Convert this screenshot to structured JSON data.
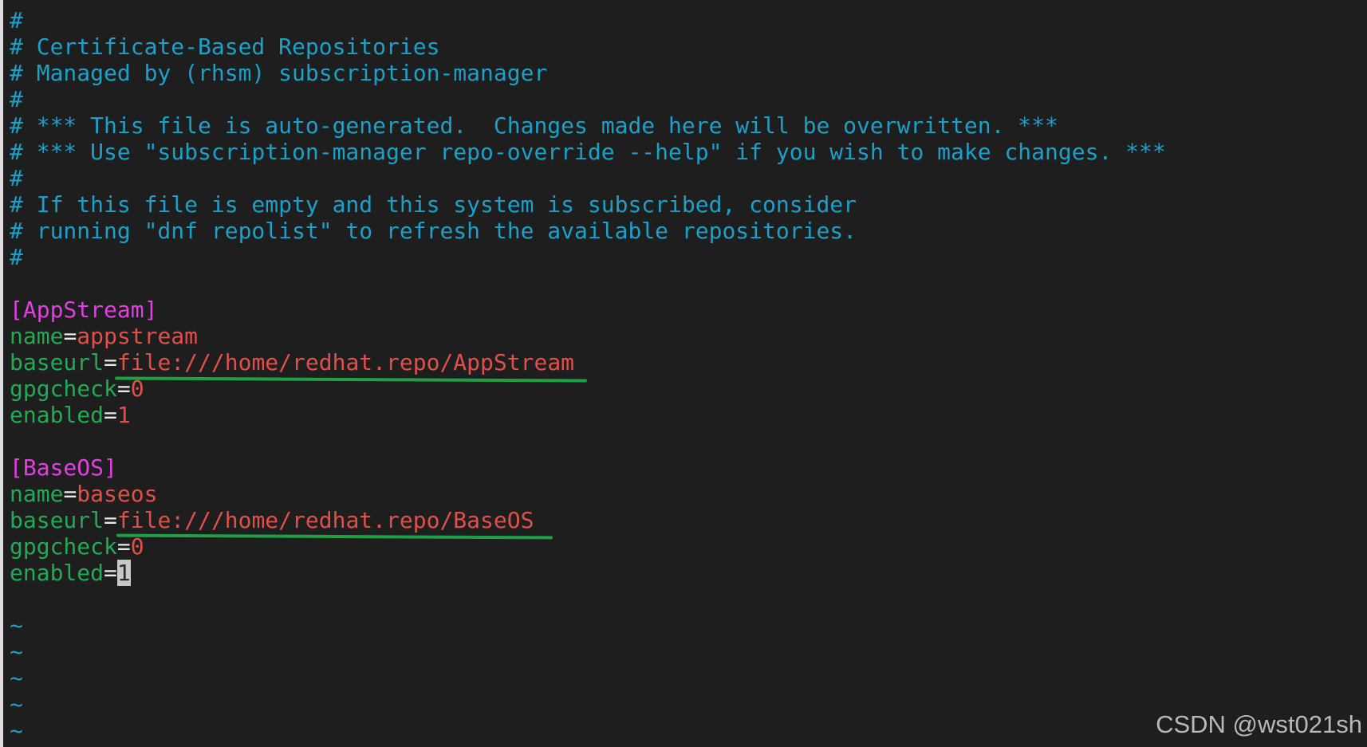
{
  "comments": [
    "#",
    "# Certificate-Based Repositories",
    "# Managed by (rhsm) subscription-manager",
    "#",
    "# *** This file is auto-generated.  Changes made here will be overwritten. ***",
    "# *** Use \"subscription-manager repo-override --help\" if you wish to make changes. ***",
    "#",
    "# If this file is empty and this system is subscribed, consider",
    "# running \"dnf repolist\" to refresh the available repositories.",
    "#"
  ],
  "repos": [
    {
      "section": "[AppStream]",
      "name_key": "name",
      "name_value": "appstream",
      "baseurl_key": "baseurl",
      "baseurl_value": "file:///home/redhat.repo/AppStream",
      "gpgcheck_key": "gpgcheck",
      "gpgcheck_value": "0",
      "enabled_key": "enabled",
      "enabled_value": "1"
    },
    {
      "section": "[BaseOS]",
      "name_key": "name",
      "name_value": "baseos",
      "baseurl_key": "baseurl",
      "baseurl_value": "file:///home/redhat.repo/BaseOS",
      "gpgcheck_key": "gpgcheck",
      "gpgcheck_value": "0",
      "enabled_key": "enabled",
      "enabled_value": "1"
    }
  ],
  "equals": "=",
  "tildes": [
    "~",
    "~",
    "~",
    "~",
    "~"
  ],
  "watermark": "CSDN @wst021sh",
  "colors": {
    "background": "#1e1e1e",
    "comment": "#1ca0c8",
    "section": "#e040e0",
    "key": "#22aa55",
    "value": "#e0504a",
    "annotation_underline": "#1fa044"
  }
}
